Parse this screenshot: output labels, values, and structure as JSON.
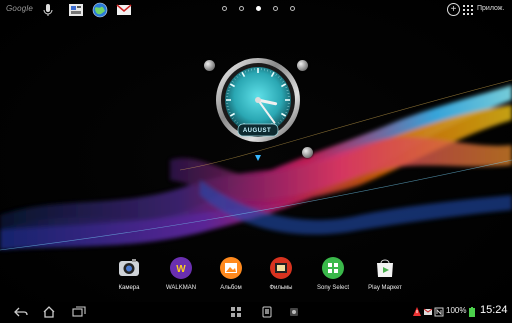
{
  "topbar": {
    "search_text": "Google",
    "icons": [
      "microphone-icon",
      "gallery-widget-icon",
      "browser-globe-icon",
      "mail-icon"
    ],
    "pages": {
      "count": 5,
      "active": 3
    },
    "add_icon": "plus-icon",
    "apps_label": "Прилож."
  },
  "clock": {
    "hour": 3,
    "minute": 24,
    "month_label": "AUGUST",
    "face_color": "#2aa7b3"
  },
  "dock": {
    "items": [
      {
        "label": "Камера",
        "icon": "camera-icon",
        "color": "#d9dde3"
      },
      {
        "label": "WALKMAN",
        "icon": "walkman-icon",
        "color": "#7a3fb8"
      },
      {
        "label": "Альбом",
        "icon": "album-icon",
        "color": "#ff8a1e"
      },
      {
        "label": "Фильмы",
        "icon": "movies-icon",
        "color": "#d8331f"
      },
      {
        "label": "Sony Select",
        "icon": "sony-select-icon",
        "color": "#3ab84a"
      },
      {
        "label": "Play Маркет",
        "icon": "play-store-icon",
        "color": "#f2f2f2"
      }
    ]
  },
  "systembar": {
    "nav": [
      "back-icon",
      "home-icon",
      "recent-apps-icon"
    ],
    "battery": "100%",
    "time": "15:24"
  }
}
